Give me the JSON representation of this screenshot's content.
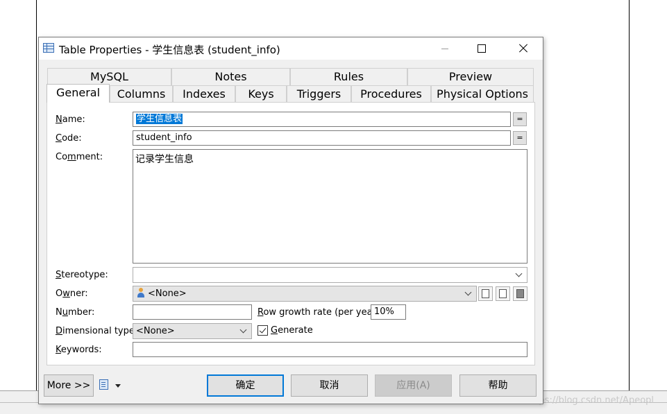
{
  "dialog": {
    "title": "Table Properties - 学生信息表 (student_info)"
  },
  "tabs": {
    "row1": [
      "MySQL",
      "Notes",
      "Rules",
      "Preview"
    ],
    "row2": [
      "General",
      "Columns",
      "Indexes",
      "Keys",
      "Triggers",
      "Procedures",
      "Physical Options"
    ],
    "active": "General"
  },
  "form": {
    "name": {
      "label_pre": "",
      "label_u": "N",
      "label_post": "ame:",
      "value": "学生信息表"
    },
    "code": {
      "label_pre": "",
      "label_u": "C",
      "label_post": "ode:",
      "value": "student_info"
    },
    "comment": {
      "label_pre": "Co",
      "label_u": "m",
      "label_post": "ment:",
      "value": "记录学生信息"
    },
    "stereotype": {
      "label_pre": "",
      "label_u": "S",
      "label_post": "tereotype:",
      "value": ""
    },
    "owner": {
      "label_pre": "O",
      "label_u": "w",
      "label_post": "ner:",
      "value": "<None>"
    },
    "number": {
      "label_pre": "N",
      "label_u": "u",
      "label_post": "mber:",
      "value": ""
    },
    "row_growth": {
      "label_pre": "",
      "label_u": "R",
      "label_post": "ow growth rate (per year):",
      "value": "10%"
    },
    "dimensional": {
      "label_pre": "",
      "label_u": "D",
      "label_post": "imensional type:",
      "value": "<None>"
    },
    "generate": {
      "label_pre": "",
      "label_u": "G",
      "label_post": "enerate",
      "checked": true
    },
    "keywords": {
      "label_pre": "",
      "label_u": "K",
      "label_post": "eywords:",
      "value": ""
    },
    "eq_symbol": "="
  },
  "buttons": {
    "more": "More >>",
    "ok": "确定",
    "cancel": "取消",
    "apply": "应用(A)",
    "help": "帮助"
  },
  "watermark": "https://blog.csdn.net/Apeopl"
}
